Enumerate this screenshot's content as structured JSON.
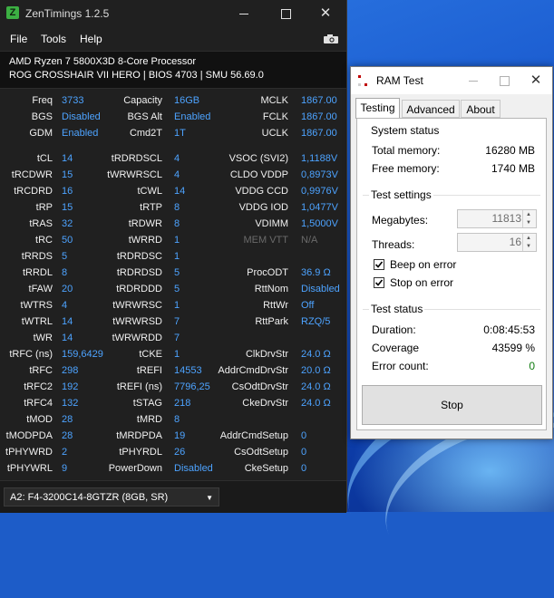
{
  "zentimings": {
    "title": "ZenTimings 1.2.5",
    "logo": "Z",
    "menu": [
      "File",
      "Tools",
      "Help"
    ],
    "cpu": "AMD Ryzen 7 5800X3D 8-Core Processor",
    "board": "ROG CROSSHAIR VII HERO | BIOS 4703 | SMU 56.69.0",
    "top": [
      [
        "Freq",
        "3733",
        "Capacity",
        "16GB",
        "MCLK",
        "1867.00"
      ],
      [
        "BGS",
        "Disabled",
        "BGS Alt",
        "Enabled",
        "FCLK",
        "1867.00"
      ],
      [
        "GDM",
        "Enabled",
        "Cmd2T",
        "1T",
        "UCLK",
        "1867.00"
      ]
    ],
    "rows": [
      [
        "tCL",
        "14",
        "tRDRDSCL",
        "4",
        "VSOC (SVI2)",
        "1,1188V"
      ],
      [
        "tRCDWR",
        "15",
        "tWRWRSCL",
        "4",
        "CLDO VDDP",
        "0,8973V"
      ],
      [
        "tRCDRD",
        "16",
        "tCWL",
        "14",
        "VDDG CCD",
        "0,9976V"
      ],
      [
        "tRP",
        "15",
        "tRTP",
        "8",
        "VDDG IOD",
        "1,0477V"
      ],
      [
        "tRAS",
        "32",
        "tRDWR",
        "8",
        "VDIMM",
        "1,5000V"
      ],
      [
        "tRC",
        "50",
        "tWRRD",
        "1",
        "MEM VTT",
        "N/A"
      ],
      [
        "tRRDS",
        "5",
        "tRDRDSC",
        "1",
        "",
        ""
      ],
      [
        "tRRDL",
        "8",
        "tRDRDSD",
        "5",
        "ProcODT",
        "36.9 Ω"
      ],
      [
        "tFAW",
        "20",
        "tRDRDDD",
        "5",
        "RttNom",
        "Disabled"
      ],
      [
        "tWTRS",
        "4",
        "tWRWRSC",
        "1",
        "RttWr",
        "Off"
      ],
      [
        "tWTRL",
        "14",
        "tWRWRSD",
        "7",
        "RttPark",
        "RZQ/5"
      ],
      [
        "tWR",
        "14",
        "tWRWRDD",
        "7",
        "",
        ""
      ],
      [
        "tRFC (ns)",
        "159,6429",
        "tCKE",
        "1",
        "ClkDrvStr",
        "24.0 Ω"
      ],
      [
        "tRFC",
        "298",
        "tREFI",
        "14553",
        "AddrCmdDrvStr",
        "20.0 Ω"
      ],
      [
        "tRFC2",
        "192",
        "tREFI (ns)",
        "7796,25",
        "CsOdtDrvStr",
        "24.0 Ω"
      ],
      [
        "tRFC4",
        "132",
        "tSTAG",
        "218",
        "CkeDrvStr",
        "24.0 Ω"
      ],
      [
        "tMOD",
        "28",
        "tMRD",
        "8",
        "",
        ""
      ],
      [
        "tMODPDA",
        "28",
        "tMRDPDA",
        "19",
        "AddrCmdSetup",
        "0"
      ],
      [
        "tPHYWRD",
        "2",
        "tPHYRDL",
        "26",
        "CsOdtSetup",
        "0"
      ],
      [
        "tPHYWRL",
        "9",
        "PowerDown",
        "Disabled",
        "CkeSetup",
        "0"
      ]
    ],
    "module": "A2: F4-3200C14-8GTZR (8GB, SR)"
  },
  "ramtest": {
    "title": "RAM Test",
    "tabs": [
      "Testing",
      "Advanced",
      "About"
    ],
    "active_tab": "Testing",
    "system_status": {
      "title": "System status",
      "total_label": "Total memory:",
      "total_value": "16280 MB",
      "free_label": "Free memory:",
      "free_value": "1740 MB"
    },
    "test_settings": {
      "title": "Test settings",
      "megabytes_label": "Megabytes:",
      "megabytes_value": "11813",
      "threads_label": "Threads:",
      "threads_value": "16",
      "beep_label": "Beep on error",
      "beep_checked": true,
      "stop_label": "Stop on error",
      "stop_checked": true
    },
    "test_status": {
      "title": "Test status",
      "duration_label": "Duration:",
      "duration_value": "0:08:45:53",
      "coverage_label": "Coverage",
      "coverage_value": "43599 %",
      "errors_label": "Error count:",
      "errors_value": "0"
    },
    "stop_button": "Stop"
  },
  "colors": {
    "value_blue": "#4da3ff",
    "error_green": "#107c10",
    "zt_bg": "#202020"
  }
}
